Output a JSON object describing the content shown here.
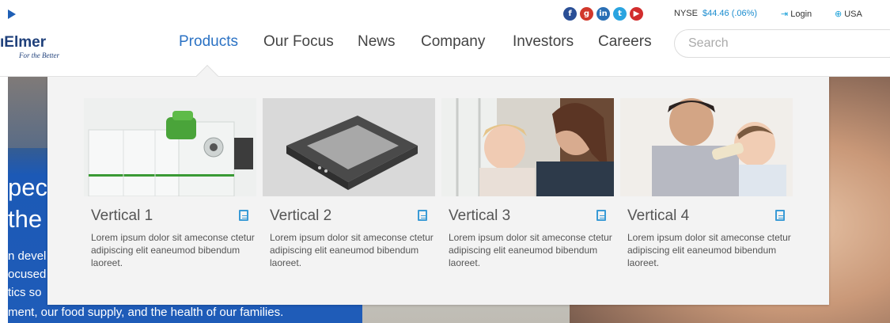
{
  "header": {
    "logo_name": "ıElmer",
    "logo_tagline": "For the Better",
    "social_icons": [
      "facebook-icon",
      "google-plus-icon",
      "linkedin-icon",
      "twitter-icon",
      "youtube-icon"
    ],
    "stock_exchange": "NYSE",
    "stock_price": "$44.46 (.06%)",
    "login_label": "Login",
    "region_label": "USA",
    "search_placeholder": "Search"
  },
  "nav": {
    "items": [
      {
        "label": "Products",
        "active": true
      },
      {
        "label": "Our Focus",
        "active": false
      },
      {
        "label": "News",
        "active": false
      },
      {
        "label": "Company",
        "active": false
      },
      {
        "label": "Investors",
        "active": false
      },
      {
        "label": "Careers",
        "active": false
      }
    ]
  },
  "mega_menu": {
    "cards": [
      {
        "title": "Vertical 1",
        "description": "Lorem ipsum dolor sit ameconse ctetur adipiscing elit eaneumod bibendum laoreet.",
        "image": "lab-instrument"
      },
      {
        "title": "Vertical 2",
        "description": "Lorem ipsum dolor sit ameconse ctetur adipiscing elit eaneumod bibendum laoreet.",
        "image": "device-plate"
      },
      {
        "title": "Vertical 3",
        "description": "Lorem ipsum dolor sit ameconse ctetur adipiscing elit eaneumod bibendum laoreet.",
        "image": "mother-and-child"
      },
      {
        "title": "Vertical 4",
        "description": "Lorem ipsum dolor sit ameconse ctetur adipiscing elit eaneumod bibendum laoreet.",
        "image": "father-feeding-baby"
      }
    ]
  },
  "hero": {
    "heading_lines": [
      "pec",
      "the"
    ],
    "body_lines": [
      "n devel",
      "ocused",
      "tics so",
      "ment, our food supply, and the health of our families."
    ]
  },
  "colors": {
    "accent": "#2b72c4",
    "price": "#1a8ccf",
    "panel_bg": "#f3f3f3",
    "hero_blue": "#1f5cb8"
  }
}
